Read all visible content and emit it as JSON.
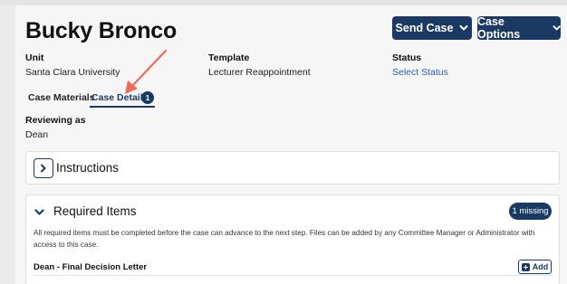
{
  "header": {
    "title": "Bucky Bronco",
    "send_case_label": "Send Case",
    "case_options_label": "Case Options"
  },
  "fields": {
    "unit_label": "Unit",
    "unit_value": "Santa Clara University",
    "template_label": "Template",
    "template_value": "Lecturer Reappointment",
    "status_label": "Status",
    "status_value": "Select Status"
  },
  "tabs": [
    {
      "label": "Case Materials",
      "active": false
    },
    {
      "label": "Case Details",
      "active": true,
      "badge": "1"
    }
  ],
  "reviewing": {
    "label": "Reviewing as",
    "value": "Dean"
  },
  "instructions": {
    "title": "Instructions"
  },
  "required_items": {
    "title": "Required Items",
    "missing_badge": "1 missing",
    "description": "All required items must be completed before the case can advance to the next step. Files can be added by any Committee Manager or Administrator with access to this case.",
    "items": [
      {
        "name": "Dean - Final Decision Letter",
        "action_label": "Add"
      }
    ]
  },
  "colors": {
    "primary": "#1b3a63",
    "link": "#1e63b6",
    "annotation_arrow": "#f06a5a"
  }
}
